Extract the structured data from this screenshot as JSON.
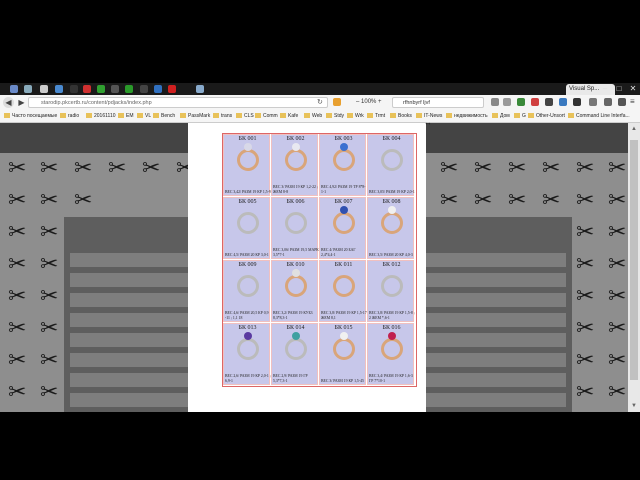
{
  "browser": {
    "active_tab_title": "Visual Sp...",
    "url": "starodip.pkcertb.ru/content/pdjacks/index.php",
    "zoom": "100%",
    "search_text": "rfhnbyrf ljvf",
    "bookmarks": [
      "Часто посещаемые",
      "radio",
      "20161110",
      "EM",
      "VL",
      "Bench",
      "PassMark",
      "trans",
      "CLS",
      "Comm",
      "Kafe",
      "Web",
      "Stdy",
      "Wrk",
      "Trmt",
      "Books",
      "IT-News",
      "недвижимость",
      "Дом",
      "G",
      "Other-Unsort",
      "Command Line Interfa..."
    ]
  },
  "catalog": {
    "items": [
      {
        "code": "БК 001",
        "desc": "ВЕС 3,42/ РАЗМ 19 КР 1,5-9",
        "gem": "#d8d8e8",
        "metal": "gold"
      },
      {
        "code": "БК 002",
        "desc": "ВЕС 3/ РАЗМ 19 КР 1,2-22 ; ЖЕМ 8-8",
        "gem": "#e8e8f0",
        "metal": "gold"
      },
      {
        "code": "БК 003",
        "desc": "ВЕС 4,92/ РАЗМ 19 ТР 8*8-1-1",
        "gem": "#3a6fd0",
        "metal": "gold"
      },
      {
        "code": "БК 004",
        "desc": "ВЕС 3,05/ РАЗМ 19 КР 2,0-1",
        "gem": "",
        "metal": "silver"
      },
      {
        "code": "БК 005",
        "desc": "ВЕС 4,5/ РАЗМ 20 КР 3,0-1",
        "gem": "",
        "metal": "silver"
      },
      {
        "code": "БК 006",
        "desc": "ВЕС 3,06/ РАЗМ 19,5 МАРК 3,5*7-1",
        "gem": "",
        "metal": "silver"
      },
      {
        "code": "БК 007",
        "desc": "ВЕС 4/ РАЗМ 20 БАГ 2,4*4,4-1",
        "gem": "#3050b0",
        "metal": "gold"
      },
      {
        "code": "БК 008",
        "desc": "ВЕС 3,5/ РАЗМ 20 КР 4,0-3",
        "gem": "#f0f0f0",
        "metal": "gold"
      },
      {
        "code": "БК 009",
        "desc": "ВЕС 4,6/ РАЗМ 20,5 КР 0,9 -11 ; 1,1 18",
        "gem": "",
        "metal": "silver"
      },
      {
        "code": "БК 010",
        "desc": "ВЕС 3,2/ РАЗМ 19 КУБ3 8,3*8,3-1",
        "gem": "#e0e0e0",
        "metal": "gold"
      },
      {
        "code": "БК 011",
        "desc": "ВЕС 3,8/ РАЗМ 19 КР 1,5-17 ЖЕМ 8,1",
        "gem": "",
        "metal": "gold"
      },
      {
        "code": "БК 012",
        "desc": "ВЕС 3,8/ РАЗМ 19 КР 1,5-8 ; 2 ЖЕМ *,6-1",
        "gem": "",
        "metal": "silver"
      },
      {
        "code": "БК 013",
        "desc": "ВЕС 2,6/ РАЗМ 19 КР 2,0-1 ; 6,9-1",
        "gem": "#5a3aa0",
        "metal": "silver"
      },
      {
        "code": "БК 014",
        "desc": "ВЕС 2,9/ РАЗМ 19 ГР 5,3*7,3-1",
        "gem": "#40a0a0",
        "metal": "silver"
      },
      {
        "code": "БК 015",
        "desc": "ВЕС 3/ РАЗМ 19 КР 1,5-45",
        "gem": "#f0f0f0",
        "metal": "gold"
      },
      {
        "code": "БК 016",
        "desc": "ВЕС 3,4/ РАЗМ 19 КР 1,6-3 ГР 7*10-1",
        "gem": "#c02050",
        "metal": "gold"
      }
    ]
  }
}
